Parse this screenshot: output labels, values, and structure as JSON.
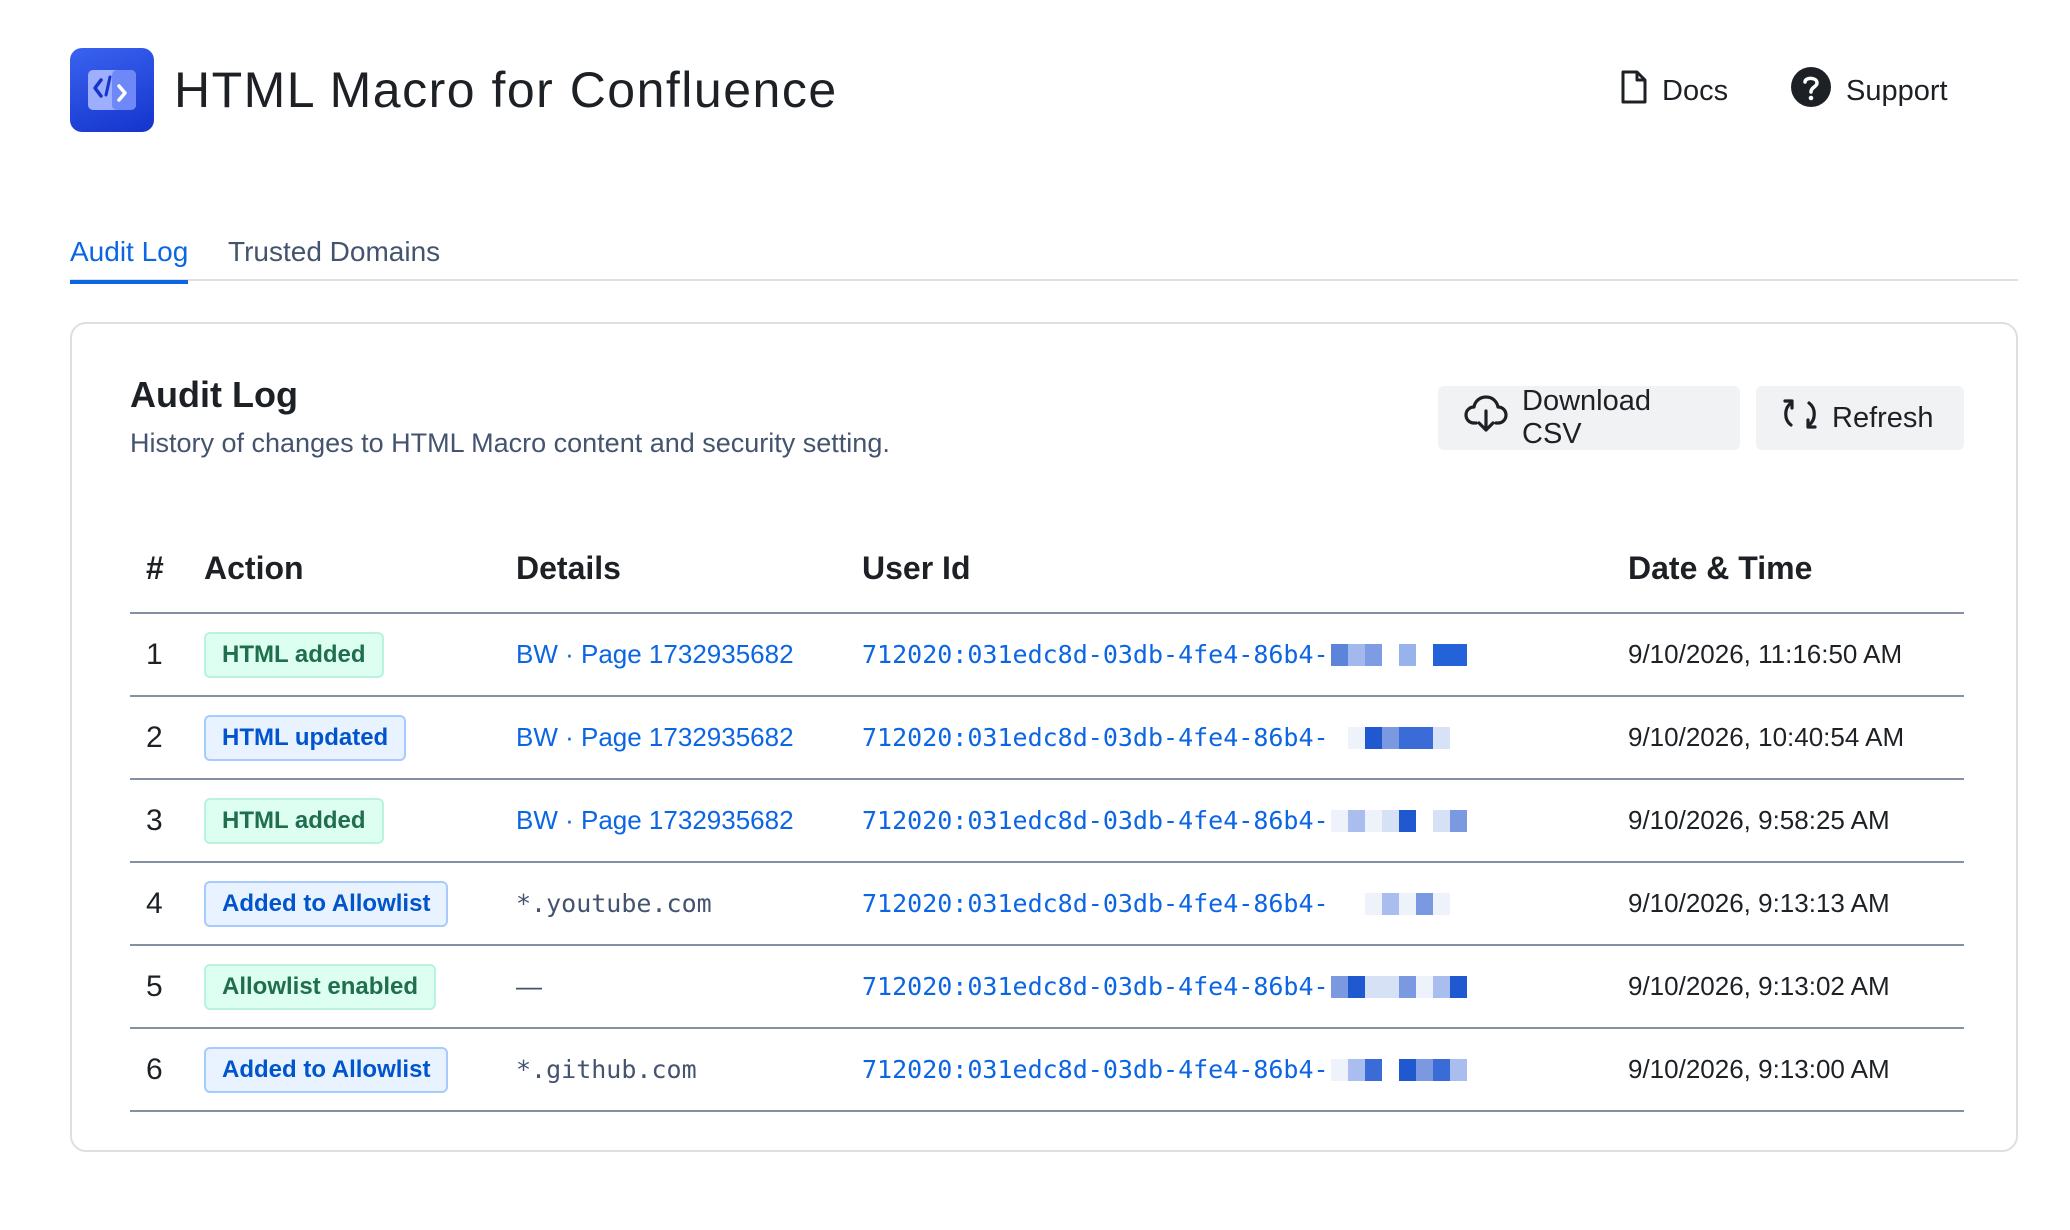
{
  "app": {
    "title": "HTML Macro for Confluence",
    "logo_icon": "code-brackets-icon",
    "brand_color": "#1f47e0"
  },
  "header": {
    "docs_label": "Docs",
    "support_label": "Support"
  },
  "tabs": [
    {
      "label": "Audit Log",
      "active": true
    },
    {
      "label": "Trusted Domains",
      "active": false
    }
  ],
  "card": {
    "title": "Audit Log",
    "subtitle": "History of changes to HTML Macro content and security setting.",
    "download_label": "Download CSV",
    "refresh_label": "Refresh"
  },
  "table": {
    "headers": [
      "#",
      "Action",
      "Details",
      "User Id",
      "Date & Time"
    ],
    "rows": [
      {
        "num": "1",
        "action": "HTML added",
        "action_color": "green",
        "details": "BW · Page 1732935682",
        "details_type": "link",
        "user_id": "712020:031edc8d-03db-4fe4-86b4-",
        "datetime": "9/10/2026, 11:16:50 AM"
      },
      {
        "num": "2",
        "action": "HTML updated",
        "action_color": "blue",
        "details": "BW · Page 1732935682",
        "details_type": "link",
        "user_id": "712020:031edc8d-03db-4fe4-86b4-",
        "datetime": "9/10/2026, 10:40:54 AM"
      },
      {
        "num": "3",
        "action": "HTML added",
        "action_color": "green",
        "details": "BW · Page 1732935682",
        "details_type": "link",
        "user_id": "712020:031edc8d-03db-4fe4-86b4-",
        "datetime": "9/10/2026, 9:58:25 AM"
      },
      {
        "num": "4",
        "action": "Added to Allowlist",
        "action_color": "blue",
        "details": "*.youtube.com",
        "details_type": "mono",
        "user_id": "712020:031edc8d-03db-4fe4-86b4-",
        "datetime": "9/10/2026, 9:13:13 AM"
      },
      {
        "num": "5",
        "action": "Allowlist enabled",
        "action_color": "green",
        "details": "—",
        "details_type": "plain",
        "user_id": "712020:031edc8d-03db-4fe4-86b4-",
        "datetime": "9/10/2026, 9:13:02 AM"
      },
      {
        "num": "6",
        "action": "Added to Allowlist",
        "action_color": "blue",
        "details": "*.github.com",
        "details_type": "mono",
        "user_id": "712020:031edc8d-03db-4fe4-86b4-",
        "datetime": "9/10/2026, 9:13:00 AM"
      }
    ]
  }
}
